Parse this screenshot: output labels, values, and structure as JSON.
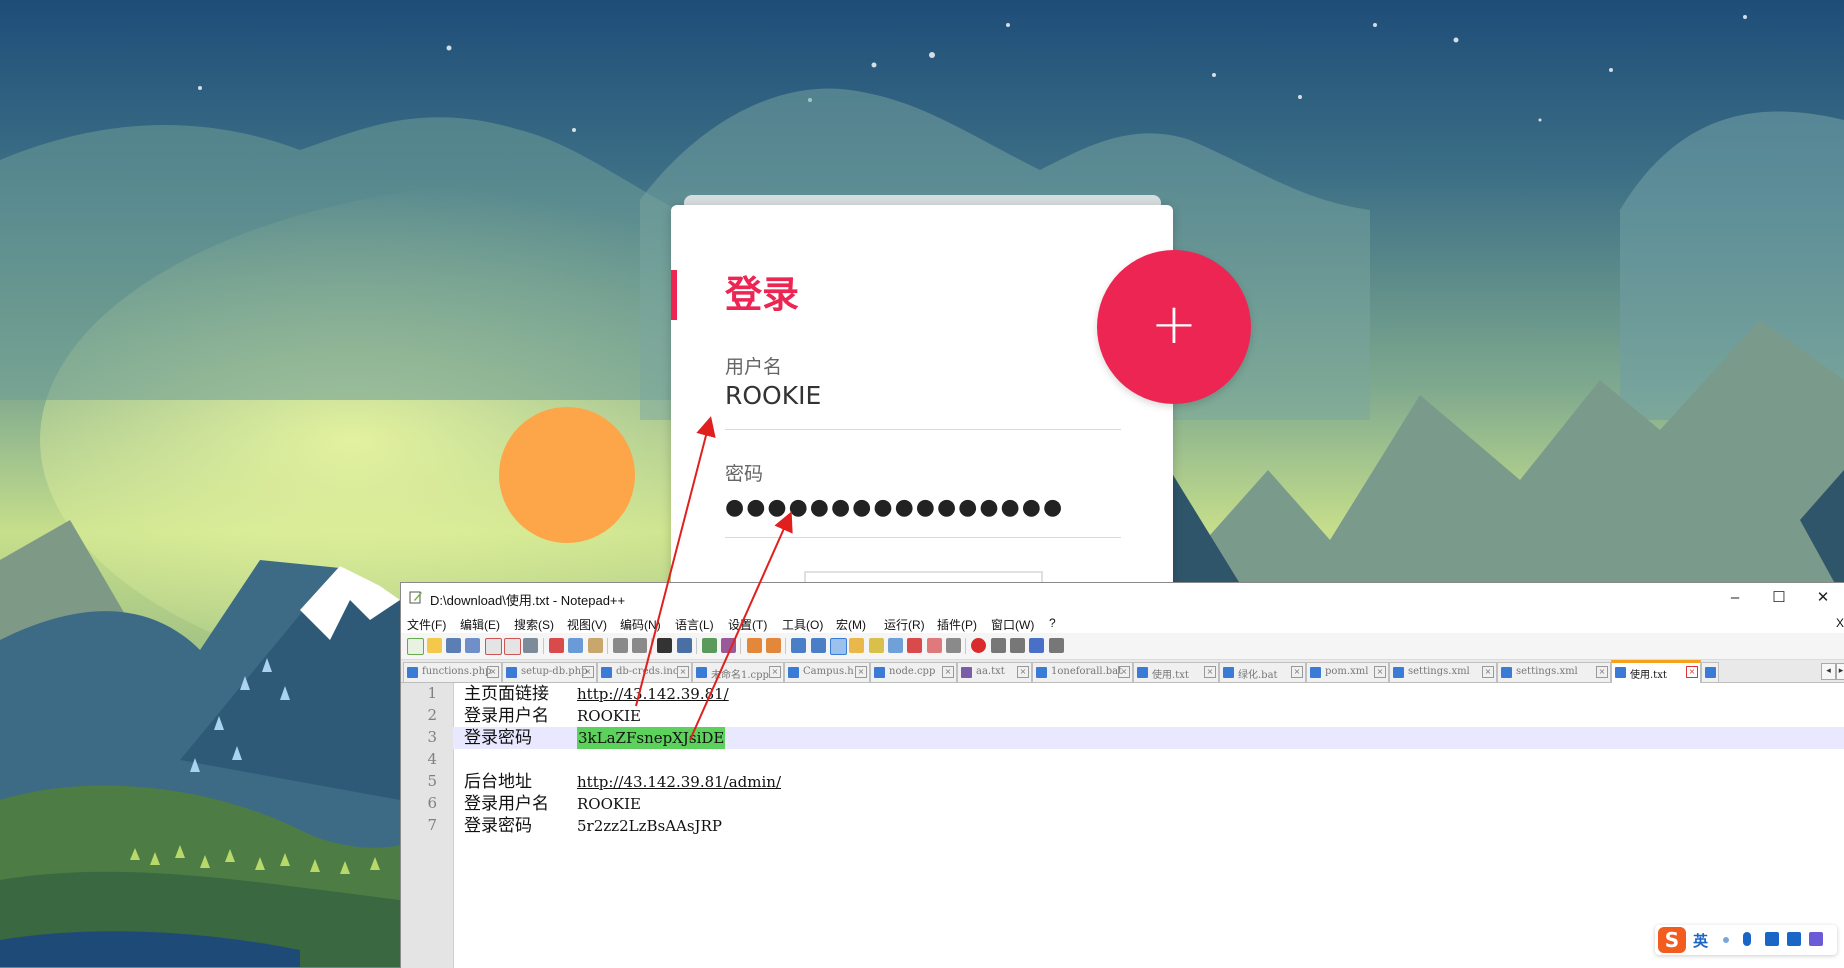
{
  "login_card": {
    "title": "登录",
    "username_label": "用户名",
    "username_value": "ROOKIE",
    "password_label": "密码",
    "password_mask": "●●●●●●●●●●●●●●●●",
    "plus_label": "+"
  },
  "notepad": {
    "window_title": "D:\\download\\使用.txt - Notepad++",
    "window_controls": {
      "minimize": "–",
      "maximize": "☐",
      "close": "✕"
    },
    "menu": [
      "文件(F)",
      "编辑(E)",
      "搜索(S)",
      "视图(V)",
      "编码(N)",
      "语言(L)",
      "设置(T)",
      "工具(O)",
      "宏(M)",
      "运行(R)",
      "插件(P)",
      "窗口(W)",
      "?"
    ],
    "menu_close": "X",
    "tabs": [
      {
        "label": "functions.php",
        "active": false
      },
      {
        "label": "setup-db.php",
        "active": false
      },
      {
        "label": "db-creds.inc",
        "active": false
      },
      {
        "label": "未命名1.cpp",
        "active": false
      },
      {
        "label": "Campus.h",
        "active": false
      },
      {
        "label": "node.cpp",
        "active": false
      },
      {
        "label": "aa.txt",
        "active": false
      },
      {
        "label": "1oneforall.bat",
        "active": false
      },
      {
        "label": "使用.txt",
        "active": false
      },
      {
        "label": "绿化.bat",
        "active": false
      },
      {
        "label": "pom.xml",
        "active": false
      },
      {
        "label": "settings.xml",
        "active": false
      },
      {
        "label": "settings.xml",
        "active": false
      },
      {
        "label": "使用.txt",
        "active": true
      }
    ],
    "tab_nav": {
      "prev": "◂",
      "next": "▸"
    },
    "lines": [
      {
        "num": "1",
        "key": "主页面链接",
        "value": "http://43.142.39.81/",
        "link": true,
        "highlight": false,
        "current": false
      },
      {
        "num": "2",
        "key": "登录用户名",
        "value": "ROOKIE",
        "link": false,
        "highlight": false,
        "current": false
      },
      {
        "num": "3",
        "key": "登录密码",
        "value": "3kLaZFsnepXJsiDE",
        "link": false,
        "highlight": true,
        "current": true
      },
      {
        "num": "4",
        "key": "",
        "value": "",
        "link": false,
        "highlight": false,
        "current": false
      },
      {
        "num": "5",
        "key": "后台地址",
        "value": "http://43.142.39.81/admin/",
        "link": true,
        "highlight": false,
        "current": false
      },
      {
        "num": "6",
        "key": "登录用户名",
        "value": "ROOKIE",
        "link": false,
        "highlight": false,
        "current": false
      },
      {
        "num": "7",
        "key": "登录密码",
        "value": "5r2zz2LzBsAAsJRP",
        "link": false,
        "highlight": false,
        "current": false
      }
    ]
  },
  "ime": {
    "logo": "S",
    "lang": "英"
  },
  "colors": {
    "accent": "#ed2553",
    "highlight": "#5cd25c",
    "arrow": "#e0201f",
    "tab_active": "#f7a11d"
  }
}
